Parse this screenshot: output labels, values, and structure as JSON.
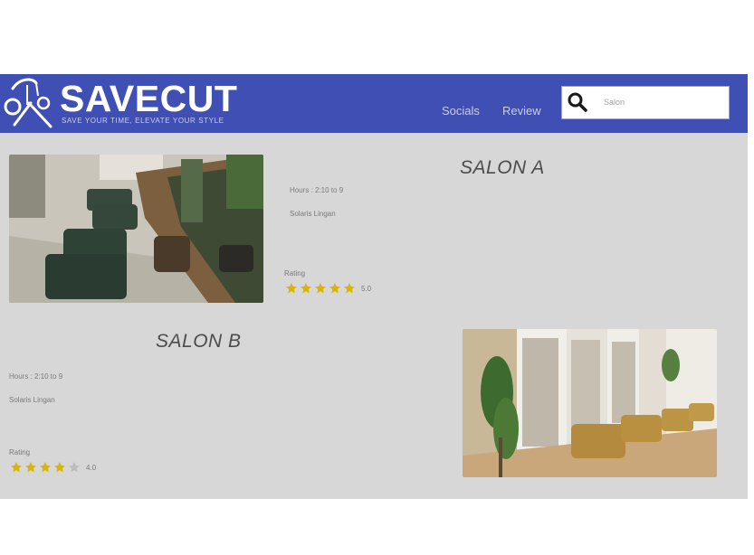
{
  "header": {
    "brand": "SAVECUT",
    "tagline": "SAVE YOUR TIME, ELEVATE YOUR STYLE",
    "nav": {
      "socials": "Socials",
      "review": "Review"
    },
    "search": {
      "placeholder": "Salon"
    }
  },
  "salons": [
    {
      "name": "SALON A",
      "hours": "Hours : 2:10 to 9",
      "location": "Solaris Lingan",
      "rating_label": "Rating",
      "rating": 5,
      "rating_count": "5.0"
    },
    {
      "name": "SALON B",
      "hours": "Hours : 2:10 to 9",
      "location": "Solaris Lingan",
      "rating_label": "Rating",
      "rating": 4,
      "rating_count": "4.0"
    }
  ],
  "colors": {
    "header_bg": "#404fb3",
    "page_bg": "#d7d7d7",
    "star_fill": "#d9b400",
    "star_empty": "#bdbdbd"
  },
  "icons": {
    "logo": "scissors-comb-icon",
    "search": "search-icon",
    "star": "star-icon"
  }
}
